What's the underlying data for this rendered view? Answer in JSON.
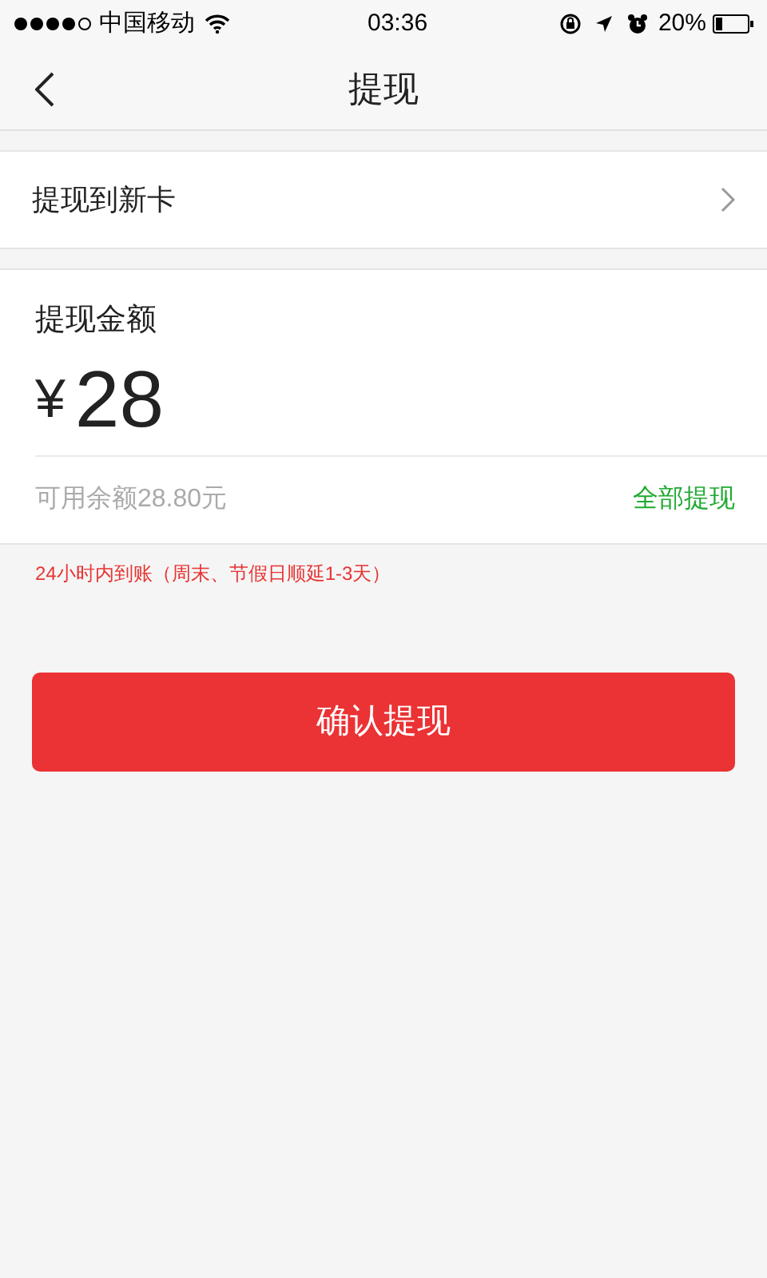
{
  "status_bar": {
    "carrier": "中国移动",
    "time": "03:36",
    "battery": "20%"
  },
  "nav_bar": {
    "title": "提现"
  },
  "card_row": {
    "label": "提现到新卡"
  },
  "amount": {
    "label": "提现金额",
    "currency": "¥",
    "value": "28",
    "balance": "可用余额28.80元",
    "withdraw_all": "全部提现"
  },
  "notice": "24小时内到账（周末、节假日顺延1-3天）",
  "confirm_button": "确认提现"
}
